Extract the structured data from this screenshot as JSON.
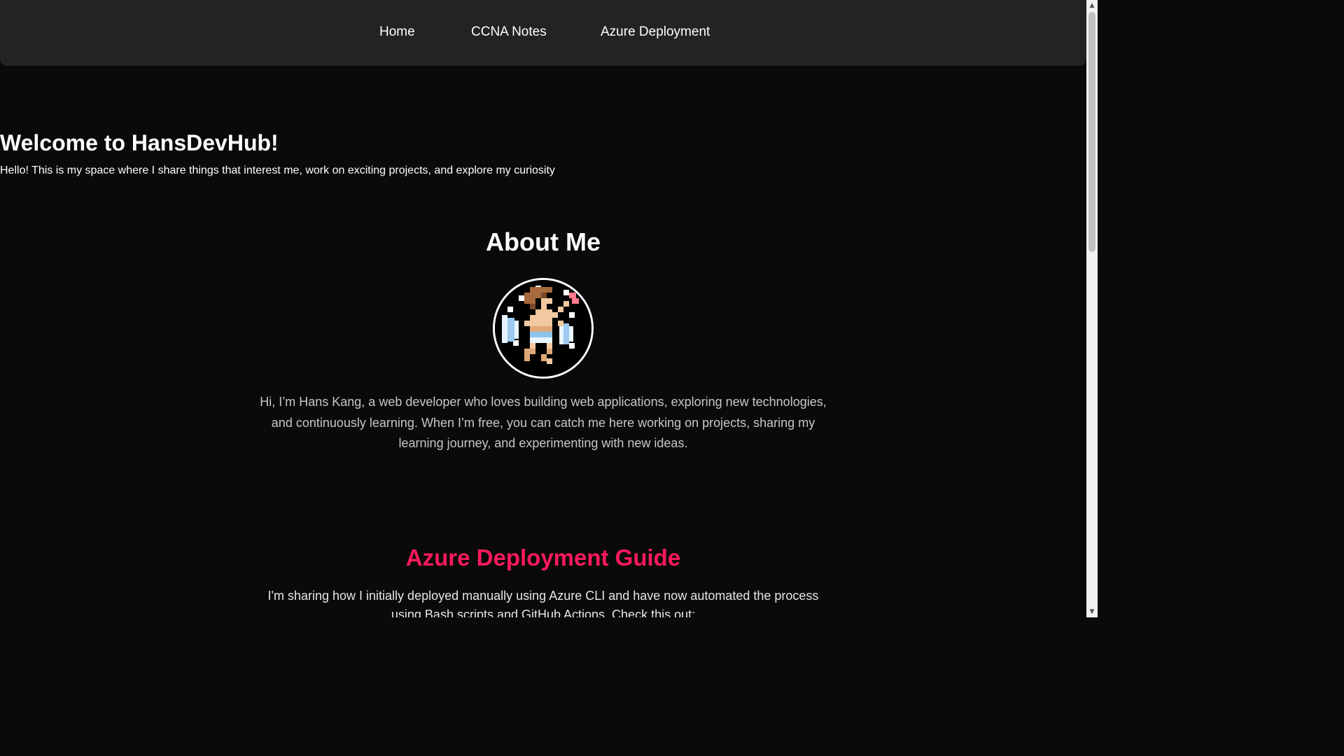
{
  "nav": {
    "items": [
      {
        "label": "Home"
      },
      {
        "label": "CCNA Notes"
      },
      {
        "label": "Azure Deployment"
      }
    ]
  },
  "hero": {
    "title": "Welcome to HansDevHub!",
    "subtitle": "Hello! This is my space where I share things that interest me, work on exciting projects, and explore my curiosity"
  },
  "about": {
    "title": "About Me",
    "avatar_icon": "pixel-art-character-icon",
    "text": "Hi, I’m Hans Kang, a web developer who loves building web applications, exploring new technologies, and continuously learning. When I’m free, you can catch me here working on projects, sharing my learning journey, and experimenting with new ideas."
  },
  "azure": {
    "title": "Azure Deployment Guide",
    "text": "I'm sharing how I initially deployed manually using Azure CLI and have now automated the process using Bash scripts and GitHub Actions. Check this out:"
  },
  "colors": {
    "background": "#0a0a0a",
    "navbar": "#232323",
    "accent": "#ff1a5c",
    "body_text": "#c7c7c7"
  },
  "scrollbar": {
    "up_icon": "scroll-up-arrow-icon",
    "down_icon": "scroll-down-arrow-icon"
  }
}
